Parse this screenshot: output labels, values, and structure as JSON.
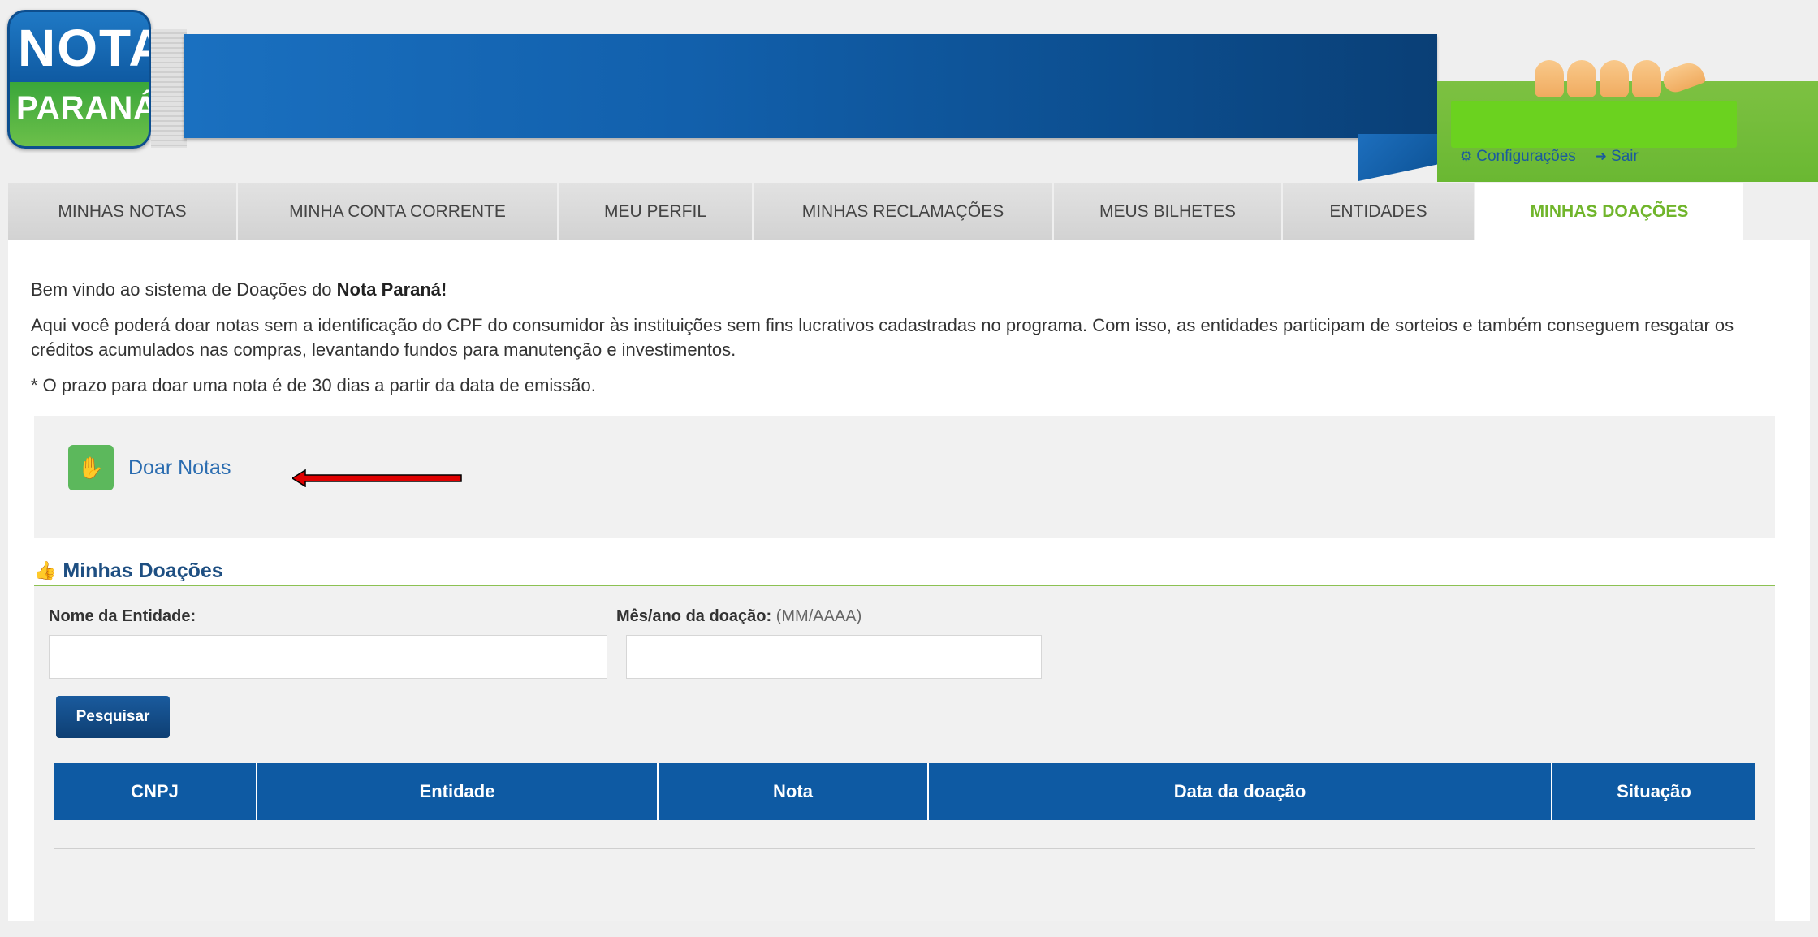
{
  "logo": {
    "line1": "NOTA",
    "line2": "PARANÁ"
  },
  "top_links": {
    "config": {
      "icon": "gear-icon",
      "label": "Configurações"
    },
    "logout": {
      "icon": "sign-out-icon",
      "label": "Sair"
    }
  },
  "tabs": [
    {
      "label": "MINHAS NOTAS",
      "active": false
    },
    {
      "label": "MINHA CONTA CORRENTE",
      "active": false
    },
    {
      "label": "MEU PERFIL",
      "active": false
    },
    {
      "label": "MINHAS RECLAMAÇÕES",
      "active": false
    },
    {
      "label": "MEUS BILHETES",
      "active": false
    },
    {
      "label": "ENTIDADES",
      "active": false
    },
    {
      "label": "MINHAS DOAÇÕES",
      "active": true
    }
  ],
  "intro": {
    "welcome_prefix": "Bem vindo ao sistema de Doações do ",
    "welcome_brand": "Nota Paraná",
    "welcome_suffix": "!",
    "description": "Aqui você poderá doar notas sem a identificação do CPF do consumidor às instituições sem fins lucrativos cadastradas no programa. Com isso, as entidades participam de sorteios e também conseguem resgatar os créditos acumulados nas compras, levantando fundos para manutenção e investimentos.",
    "deadline": "* O prazo para doar uma nota é de 30 dias a partir da data de emissão."
  },
  "donate": {
    "icon": "hand-icon",
    "label": "Doar Notas"
  },
  "section": {
    "icon": "thumbs-up-icon",
    "title": "Minhas Doações"
  },
  "filters": {
    "entity_label": "Nome da Entidade:",
    "entity_value": "",
    "date_label": "Mês/ano da doação:",
    "date_hint": "(MM/AAAA)",
    "date_value": "",
    "search_button": "Pesquisar"
  },
  "table": {
    "columns": [
      "CNPJ",
      "Entidade",
      "Nota",
      "Data da doação",
      "Situação"
    ],
    "rows": []
  },
  "colors": {
    "brand_blue": "#0e5aa3",
    "brand_green": "#6ab832",
    "active_tab": "#70b52b",
    "annotation_arrow": "#e00000"
  }
}
